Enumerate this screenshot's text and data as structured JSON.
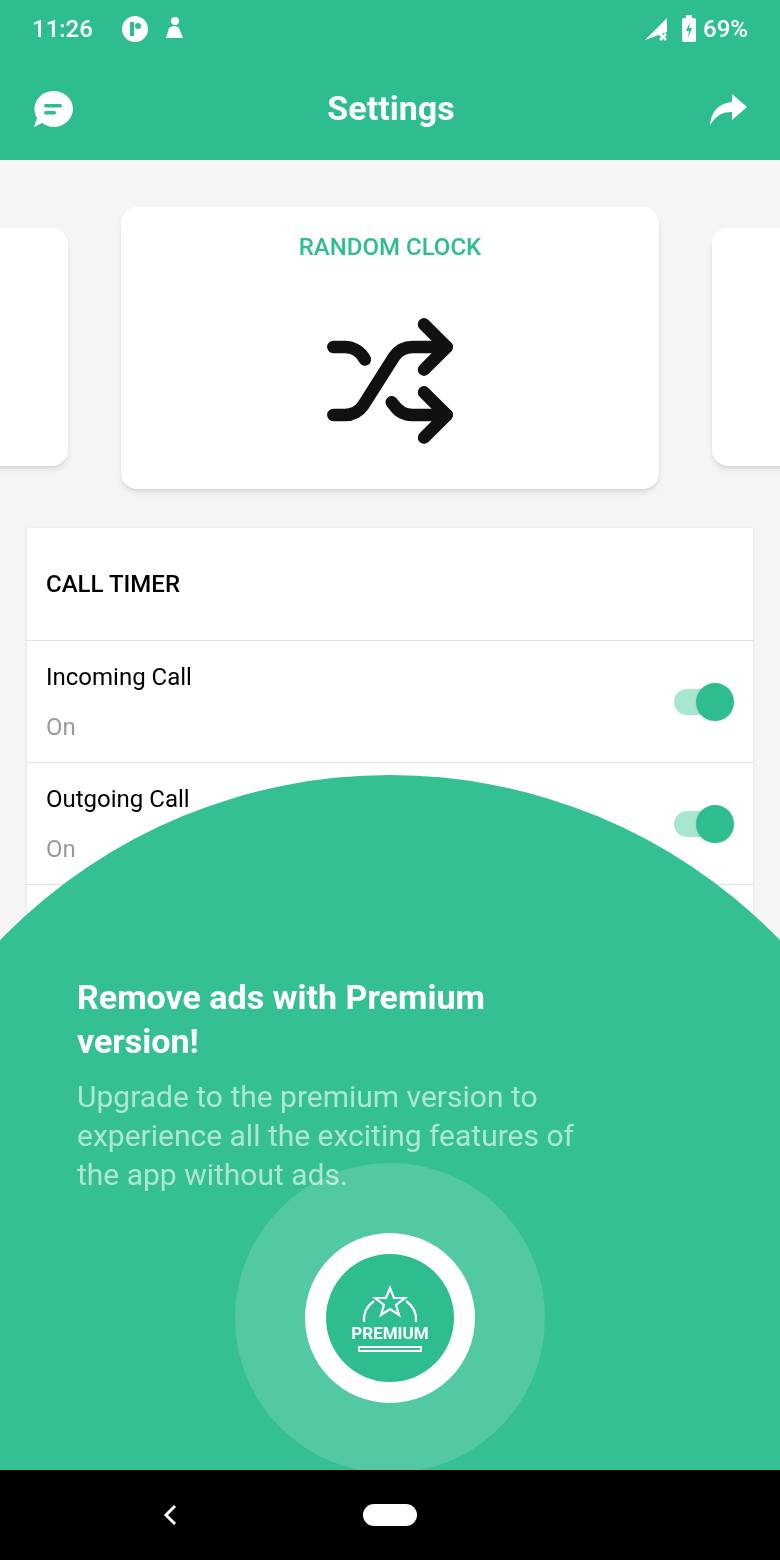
{
  "status_bar": {
    "time": "11:26",
    "battery": "69%"
  },
  "app_bar": {
    "title": "Settings"
  },
  "carousel": {
    "title": "RANDOM CLOCK"
  },
  "call_timer": {
    "heading": "CALL TIMER",
    "rows": [
      {
        "label": "Incoming Call",
        "value": "On",
        "on": true
      },
      {
        "label": "Outgoing Call",
        "value": "On",
        "on": true
      }
    ]
  },
  "premium": {
    "title": "Remove ads with Premium version!",
    "message": "Upgrade to the premium version to experience all the exciting features of the app without ads.",
    "badge": "PREMIUM"
  }
}
